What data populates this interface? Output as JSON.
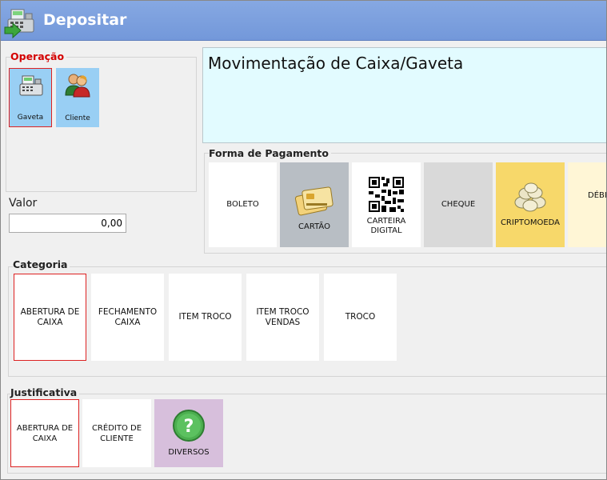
{
  "window": {
    "title": "Depositar",
    "icon": "cash-register-icon"
  },
  "operacao": {
    "label": "Operação",
    "items": [
      {
        "label": "Gaveta",
        "icon": "cash-register-icon",
        "selected": true
      },
      {
        "label": "Cliente",
        "icon": "user-icon",
        "selected": false
      }
    ]
  },
  "valor": {
    "label": "Valor",
    "value": "0,00"
  },
  "descricao": {
    "text": "Movimentação de Caixa/Gaveta"
  },
  "forma_pagamento": {
    "label": "Forma de Pagamento",
    "items": [
      {
        "label": "BOLETO",
        "bg": "#ffffff"
      },
      {
        "label": "CARTÃO",
        "bg": "#b8bec4",
        "icon": "credit-card-icon"
      },
      {
        "label": "CARTEIRA DIGITAL",
        "bg": "#ffffff",
        "icon": "qr-code-icon"
      },
      {
        "label": "CHEQUE",
        "bg": "#d9d9d9"
      },
      {
        "label": "CRIPTOMOEDA",
        "bg": "#f7d86a",
        "icon": "coins-icon"
      },
      {
        "label": "DÉBITO",
        "bg": "#fff6d6"
      }
    ]
  },
  "categoria": {
    "label": "Categoria",
    "items": [
      {
        "label": "ABERTURA DE CAIXA",
        "selected": true
      },
      {
        "label": "FECHAMENTO CAIXA",
        "selected": false
      },
      {
        "label": "ITEM TROCO",
        "selected": false
      },
      {
        "label": "ITEM TROCO VENDAS",
        "selected": false
      },
      {
        "label": "TROCO",
        "selected": false
      }
    ]
  },
  "justificativa": {
    "label": "Justificativa",
    "items": [
      {
        "label": "ABERTURA DE CAIXA",
        "selected": true,
        "bg": "#ffffff"
      },
      {
        "label": "CRÉDITO DE CLIENTE",
        "selected": false,
        "bg": "#ffffff"
      },
      {
        "label": "DIVERSOS",
        "selected": false,
        "bg": "#d7bfdc",
        "icon": "help-question-icon"
      }
    ]
  },
  "colors": {
    "title_bar": "#7398da",
    "selected_border": "#d22222",
    "operation_tile": "#99cff4"
  }
}
